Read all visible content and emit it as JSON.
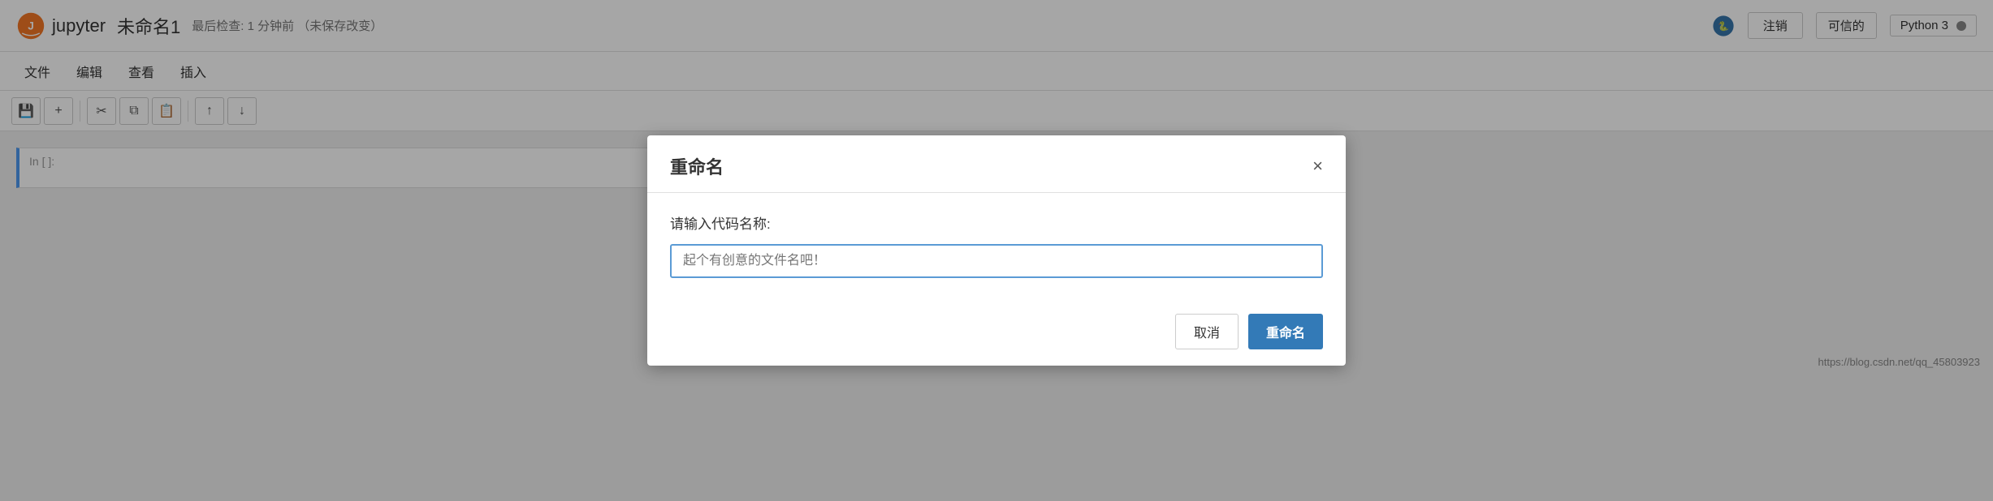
{
  "navbar": {
    "brand": "jupyter",
    "title": "未命名1",
    "meta": "最后检查: 1 分钟前  （未保存改变）",
    "logout_label": "注销",
    "trusted_label": "可信的",
    "kernel_label": "Python 3"
  },
  "menubar": {
    "items": [
      "文件",
      "编辑",
      "查看",
      "插入"
    ]
  },
  "toolbar": {
    "save_icon": "💾",
    "add_icon": "+",
    "cut_icon": "✂",
    "copy_icon": "⧉",
    "paste_icon": "📋",
    "up_icon": "↑",
    "down_icon": "↓"
  },
  "cell": {
    "label": "In [ ]:"
  },
  "modal": {
    "title": "重命名",
    "close_icon": "×",
    "label": "请输入代码名称:",
    "input_placeholder": "起个有创意的文件名吧！",
    "cancel_label": "取消",
    "rename_label": "重命名"
  },
  "url": "https://blog.csdn.net/qq_45803923"
}
